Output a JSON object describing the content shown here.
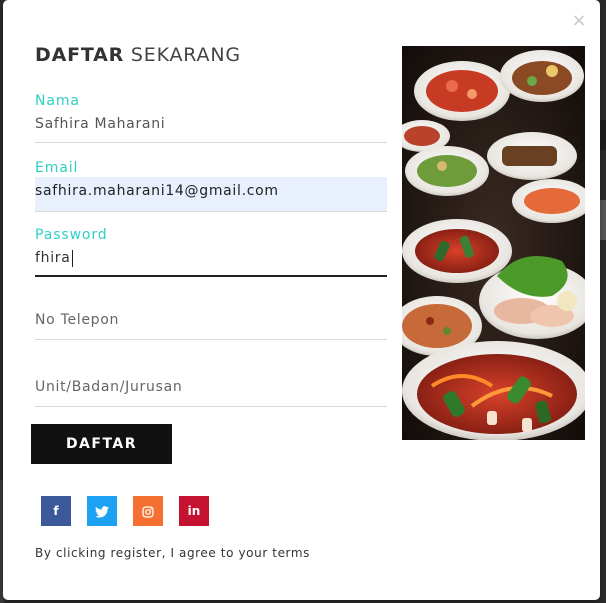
{
  "modal": {
    "close_icon_glyph": "×",
    "title_bold": "DAFTAR",
    "title_light": "SEKARANG"
  },
  "form": {
    "nama": {
      "label": "Nama",
      "value": "Safhira Maharani"
    },
    "email": {
      "label": "Email",
      "value": "safhira.maharani14@gmail.com"
    },
    "password": {
      "label": "Password",
      "value": "fhira"
    },
    "telepon": {
      "placeholder": "No Telepon"
    },
    "unit": {
      "placeholder": "Unit/Badan/Jurusan"
    },
    "submit_label": "DAFTAR"
  },
  "social": {
    "facebook": "f",
    "twitter": "twitter-icon",
    "instagram": "instagram-icon",
    "linkedin": "in"
  },
  "terms_text": "By clicking register, I agree to your terms",
  "colors": {
    "label_accent": "#2fd0c3",
    "button_bg": "#111111",
    "autofill_bg": "#e8f0fe",
    "facebook": "#3b5998",
    "twitter": "#1da1f2",
    "instagram": "#f46f30",
    "linkedin": "#c41230"
  }
}
